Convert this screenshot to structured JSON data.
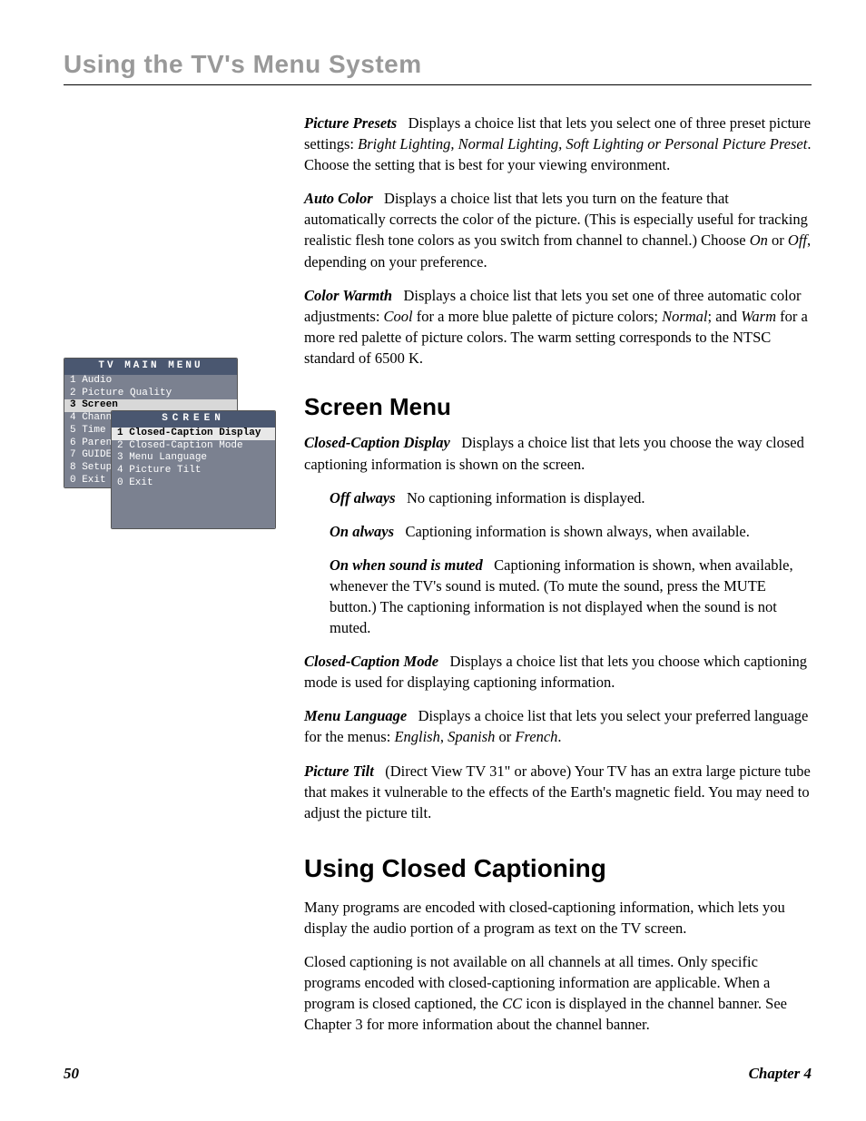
{
  "header": "Using the TV's Menu System",
  "osd": {
    "main_title": "TV MAIN MENU",
    "items": [
      "1 Audio",
      "2 Picture Quality",
      "3 Screen",
      "4 Chann",
      "5 Time",
      "6 Paren",
      "7 GUIDE",
      "8 Setup",
      "0 Exit"
    ],
    "selected_index": 2,
    "sub_title": "SCREEN",
    "sub_items": [
      "1 Closed-Caption Display",
      "2 Closed-Caption Mode",
      "3 Menu Language",
      "4 Picture Tilt",
      "0 Exit"
    ],
    "sub_selected_index": 0
  },
  "picture_presets": {
    "label": "Picture Presets",
    "pre": "Displays a choice list that lets you select one of three preset picture settings: ",
    "opts": "Bright Lighting, Normal Lighting, Soft Lighting or Personal Picture Preset",
    "post": ". Choose the setting that is best for your viewing environment."
  },
  "auto_color": {
    "label": "Auto Color",
    "pre": "Displays a choice list that lets you turn on the feature that automatically corrects the color of the picture. (This is especially useful for tracking realistic flesh tone colors as you switch from channel to channel.) Choose ",
    "on": "On",
    "mid": " or ",
    "off": "Off",
    "post": ", depending on your preference."
  },
  "color_warmth": {
    "label": "Color Warmth",
    "pre": "Displays a choice list that lets you set one of three automatic color adjustments: ",
    "cool": "Cool",
    "mid1": " for a more blue palette of picture colors; ",
    "normal": "Normal",
    "mid2": "; and ",
    "warm": "Warm",
    "post": " for a more red palette of picture colors. The warm setting corresponds to the NTSC standard of 6500 K."
  },
  "screen_heading": "Screen Menu",
  "ccd": {
    "label": "Closed-Caption Display",
    "text": "Displays a choice list that lets you choose the way closed captioning information is shown on the screen."
  },
  "ccd_off": {
    "label": "Off always",
    "text": "No captioning information is displayed."
  },
  "ccd_on": {
    "label": "On always",
    "text": "Captioning information is shown always, when available."
  },
  "ccd_mute": {
    "label": "On when sound is muted",
    "text": "Captioning information is shown, when available, whenever the TV's sound is muted. (To mute the sound, press the MUTE button.) The captioning information is not displayed when the sound is not muted."
  },
  "ccm": {
    "label": "Closed-Caption Mode",
    "text": "Displays a choice list that lets you choose which captioning mode is used for displaying captioning information."
  },
  "menu_lang": {
    "label": "Menu Language",
    "pre": "Displays a choice list that lets you select your preferred language for the menus: ",
    "e": "English",
    "c1": ", ",
    "s": "Spanish",
    "c2": " or ",
    "f": "French",
    "post": "."
  },
  "tilt": {
    "label": "Picture Tilt",
    "text": "(Direct View TV 31\" or above) Your TV has an extra large picture tube that makes it vulnerable to the effects of the Earth's magnetic field. You may need to adjust the picture tilt."
  },
  "ucc_heading": "Using Closed Captioning",
  "ucc_p1": "Many programs are encoded with closed-captioning information, which lets you display the audio portion of a program as text on the TV screen.",
  "ucc_p2_pre": "Closed captioning is not available on all channels at all times. Only specific programs encoded with closed-captioning information are applicable. When a program is closed captioned, the ",
  "ucc_p2_cc": "CC",
  "ucc_p2_post": " icon is displayed in the channel banner. See Chapter 3 for more information about the channel banner.",
  "footer": {
    "page": "50",
    "chapter": "Chapter 4"
  }
}
